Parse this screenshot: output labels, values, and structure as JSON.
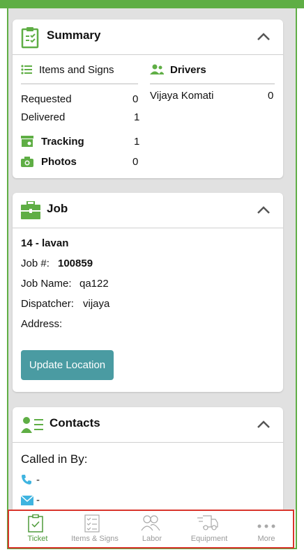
{
  "summary": {
    "title": "Summary",
    "items_header": "Items and Signs",
    "drivers_header": "Drivers",
    "requested_label": "Requested",
    "requested_value": "0",
    "delivered_label": "Delivered",
    "delivered_value": "1",
    "tracking_label": "Tracking",
    "tracking_value": "1",
    "photos_label": "Photos",
    "photos_value": "0",
    "driver_name": "Vijaya Komati",
    "driver_value": "0"
  },
  "job": {
    "title": "Job",
    "name": "14 - lavan",
    "job_no_label": "Job #:",
    "job_no_value": "100859",
    "job_name_label": "Job Name:",
    "job_name_value": "qa122",
    "dispatcher_label": "Dispatcher:",
    "dispatcher_value": "vijaya",
    "address_label": "Address:",
    "update_button": "Update Location"
  },
  "contacts": {
    "title": "Contacts",
    "called_in_by_label": "Called in By:",
    "phone_value": "-",
    "email_value": "-"
  },
  "tabs": [
    {
      "label": "Ticket",
      "icon": "clipboard-check-icon",
      "active": true
    },
    {
      "label": "Items & Signs",
      "icon": "checklist-icon",
      "active": false
    },
    {
      "label": "Labor",
      "icon": "people-icon",
      "active": false
    },
    {
      "label": "Equipment",
      "icon": "truck-icon",
      "active": false
    },
    {
      "label": "More",
      "icon": "more-dots-icon",
      "active": false
    }
  ],
  "colors": {
    "brand_green": "#5fae45",
    "button_teal": "#4a9ba2",
    "highlight_red": "#d9342b",
    "icon_blue": "#3fb4e0"
  }
}
